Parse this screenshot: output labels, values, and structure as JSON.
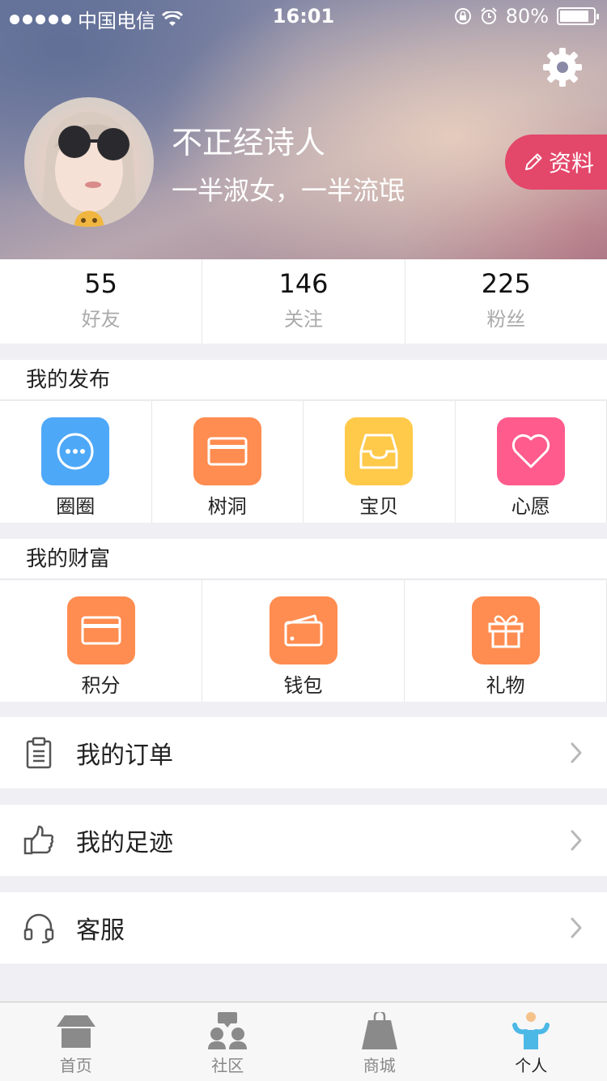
{
  "status_bar": {
    "carrier": "中国电信",
    "time": "16:01",
    "battery": "80%"
  },
  "profile": {
    "name": "不正经诗人",
    "bio": "一半淑女，一半流氓",
    "edit_label": "资料"
  },
  "stats": [
    {
      "value": "55",
      "label": "好友"
    },
    {
      "value": "146",
      "label": "关注"
    },
    {
      "value": "225",
      "label": "粉丝"
    }
  ],
  "publish": {
    "title": "我的发布",
    "items": [
      {
        "label": "圈圈",
        "icon": "chat-bubble-icon",
        "color": "#4ea8f8"
      },
      {
        "label": "树洞",
        "icon": "card-icon",
        "color": "#ff8c50"
      },
      {
        "label": "宝贝",
        "icon": "inbox-tray-icon",
        "color": "#ffc94a"
      },
      {
        "label": "心愿",
        "icon": "heart-icon",
        "color": "#ff5b8c"
      }
    ]
  },
  "wealth": {
    "title": "我的财富",
    "items": [
      {
        "label": "积分",
        "icon": "card-icon",
        "color": "#ff8c50"
      },
      {
        "label": "钱包",
        "icon": "wallet-icon",
        "color": "#ff8c50"
      },
      {
        "label": "礼物",
        "icon": "gift-icon",
        "color": "#ff8c50"
      }
    ]
  },
  "menu": [
    {
      "label": "我的订单",
      "icon": "clipboard-icon"
    },
    {
      "label": "我的足迹",
      "icon": "thumbs-up-icon"
    },
    {
      "label": "客服",
      "icon": "headset-icon"
    }
  ],
  "tabs": [
    {
      "label": "首页",
      "icon": "house-icon",
      "active": false
    },
    {
      "label": "社区",
      "icon": "community-icon",
      "active": false
    },
    {
      "label": "商城",
      "icon": "shopping-bag-icon",
      "active": false
    },
    {
      "label": "个人",
      "icon": "person-icon",
      "active": true,
      "color": "#4cb8e6"
    }
  ]
}
